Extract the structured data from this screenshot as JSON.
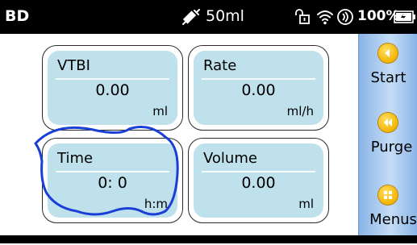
{
  "statusbar": {
    "brand": "BD",
    "syringe_volume": "50ml",
    "battery_percent": "100%",
    "icons": [
      "syringe-icon",
      "lock-icon",
      "wifi-icon",
      "signal-icon",
      "battery-icon"
    ]
  },
  "cards": {
    "vtbi": {
      "label": "VTBI",
      "value": "0.00",
      "unit": "ml"
    },
    "rate": {
      "label": "Rate",
      "value": "0.00",
      "unit": "ml/h"
    },
    "time": {
      "label": "Time",
      "value": "0: 0",
      "unit": "h:m"
    },
    "volume": {
      "label": "Volume",
      "value": "0.00",
      "unit": "ml"
    }
  },
  "sidemenu": {
    "start": "Start",
    "purge": "Purge",
    "menus": "Menus"
  },
  "colors": {
    "statusbar_bg": "#000000",
    "card_fill": "#bfe1ec",
    "sidemenu_bg": "#a9c9f0",
    "button_accent": "#f2b400",
    "annotation_ink": "#1a3fd6"
  }
}
